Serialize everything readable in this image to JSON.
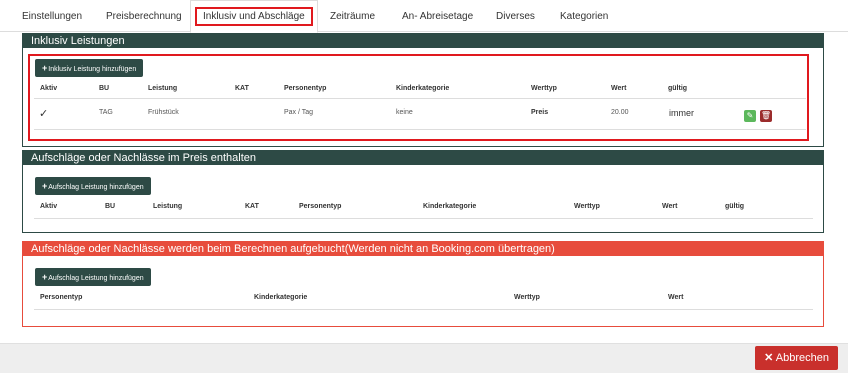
{
  "tabs": [
    {
      "label": "Einstellungen"
    },
    {
      "label": "Preisberechnung"
    },
    {
      "label": "Inklusiv und Abschläge"
    },
    {
      "label": "Zeiträume"
    },
    {
      "label": "An- Abreisetage"
    },
    {
      "label": "Diverses"
    },
    {
      "label": "Kategorien"
    }
  ],
  "inclusive": {
    "title": "Inklusiv Leistungen",
    "add_label": "Inklusiv Leistung hinzufügen",
    "headers": [
      "Aktiv",
      "BU",
      "Leistung",
      "KAT",
      "Personentyp",
      "Kinderkategorie",
      "Werttyp",
      "Wert",
      "gültig"
    ],
    "row": {
      "aktiv": "✓",
      "bu": "TAG",
      "leistung": "Frühstück",
      "kat": "",
      "personentyp": "Pax / Tag",
      "kinderkategorie": "keine",
      "werttyp": "Preis",
      "wert": "20.00",
      "gueltig": "immer"
    }
  },
  "included_surcharges": {
    "title": "Aufschläge oder Nachlässe im Preis enthalten",
    "add_label": "Aufschlag Leistung hinzufügen",
    "headers": [
      "Aktiv",
      "BU",
      "Leistung",
      "KAT",
      "Personentyp",
      "Kinderkategorie",
      "Werttyp",
      "Wert",
      "gültig"
    ]
  },
  "booked_surcharges": {
    "title": "Aufschläge oder Nachlässe werden beim Berechnen aufgebucht(Werden nicht an Booking.com übertragen)",
    "add_label": "Aufschlag Leistung hinzufügen",
    "headers": [
      "Personentyp",
      "Kinderkategorie",
      "Werttyp",
      "Wert"
    ]
  },
  "footer": {
    "cancel_label": "Abbrechen"
  },
  "colors": {
    "section_header": "#2d4a45",
    "booked_header": "#e74c3c",
    "cancel_button": "#c9302c",
    "highlight": "#e0191e"
  }
}
